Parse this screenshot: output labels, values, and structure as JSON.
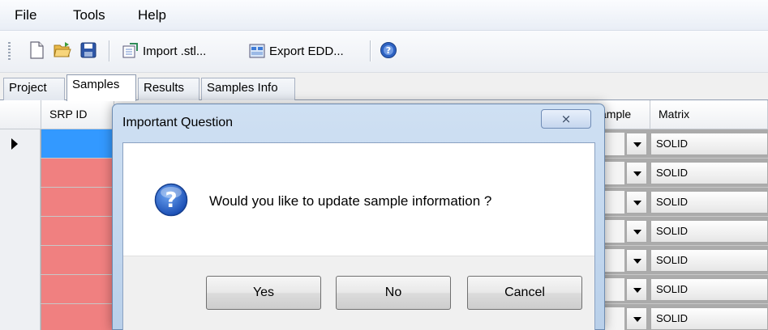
{
  "menu": {
    "file": "File",
    "tools": "Tools",
    "help": "Help"
  },
  "toolbar": {
    "new_icon": "new-document-icon",
    "open_icon": "open-folder-icon",
    "save_icon": "save-disk-icon",
    "import_label": "Import .stl...",
    "export_label": "Export EDD...",
    "help_icon": "help-circle-icon"
  },
  "tabs": [
    {
      "label": "Project",
      "active": false
    },
    {
      "label": "Samples",
      "active": true
    },
    {
      "label": "Results",
      "active": false
    },
    {
      "label": "Samples Info",
      "active": false
    }
  ],
  "grid": {
    "columns": {
      "srp_id": "SRP ID",
      "sample": "ample",
      "matrix": "Matrix"
    },
    "rows": [
      {
        "matrix": "SOLID",
        "selected": true
      },
      {
        "matrix": "SOLID",
        "selected": false
      },
      {
        "matrix": "SOLID",
        "selected": false
      },
      {
        "matrix": "SOLID",
        "selected": false
      },
      {
        "matrix": "SOLID",
        "selected": false
      },
      {
        "matrix": "SOLID",
        "selected": false
      },
      {
        "matrix": "SOLID",
        "selected": false
      }
    ]
  },
  "dialog": {
    "title": "Important Question",
    "close_glyph": "⨯",
    "message": "Would you like to update sample information ?",
    "icon": "question-icon",
    "buttons": {
      "yes": "Yes",
      "no": "No",
      "cancel": "Cancel"
    }
  },
  "colors": {
    "row_error": "#f08080",
    "row_selected": "#3399ff",
    "dialog_frame": "#b9d0ea"
  }
}
